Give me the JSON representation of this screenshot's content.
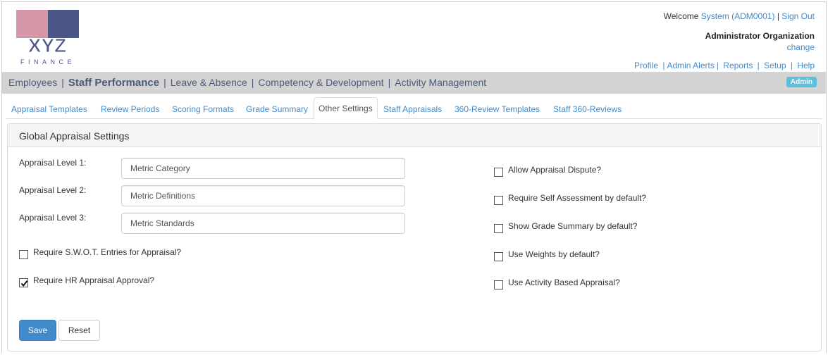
{
  "brand": {
    "logo_text": "XYZ",
    "logo_subtext": "FINANCE",
    "colors": {
      "pink": "#d596a8",
      "navy": "#4a5688"
    }
  },
  "header": {
    "welcome_label": "Welcome",
    "user_link": "System (ADM0001)",
    "separator": "|",
    "sign_out": "Sign Out",
    "organization": "Administrator Organization",
    "change_link": "change",
    "links": [
      "Profile",
      "Admin Alerts",
      "Reports",
      "Setup",
      "Help"
    ]
  },
  "main_nav": {
    "items": [
      {
        "label": "Employees",
        "active": false
      },
      {
        "label": "Staff Performance",
        "active": true
      },
      {
        "label": "Leave & Absence",
        "active": false
      },
      {
        "label": "Competency & Development",
        "active": false
      },
      {
        "label": "Activity Management",
        "active": false
      }
    ],
    "separator": "|",
    "role_badge": "Admin"
  },
  "sub_tabs": [
    {
      "label": "Appraisal Templates",
      "active": false
    },
    {
      "label": "Review Periods",
      "active": false
    },
    {
      "label": "Scoring Formats",
      "active": false
    },
    {
      "label": "Grade Summary",
      "active": false
    },
    {
      "label": "Other Settings",
      "active": true
    },
    {
      "label": "Staff Appraisals",
      "active": false
    },
    {
      "label": "360-Review Templates",
      "active": false
    },
    {
      "label": "Staff 360-Reviews",
      "active": false
    }
  ],
  "panel": {
    "title": "Global Appraisal Settings",
    "levels": [
      {
        "label": "Appraisal Level 1:",
        "value": "Metric Category"
      },
      {
        "label": "Appraisal Level 2:",
        "value": "Metric Definitions"
      },
      {
        "label": "Appraisal Level 3:",
        "value": "Metric Standards"
      }
    ],
    "left_checkboxes": [
      {
        "label": "Require S.W.O.T. Entries for Appraisal?",
        "checked": false
      },
      {
        "label": "Require HR Appraisal Approval?",
        "checked": true
      }
    ],
    "right_checkboxes": [
      {
        "label": "Allow Appraisal Dispute?",
        "checked": false
      },
      {
        "label": "Require Self Assessment by default?",
        "checked": false
      },
      {
        "label": "Show Grade Summary by default?",
        "checked": false
      },
      {
        "label": "Use Weights by default?",
        "checked": false
      },
      {
        "label": "Use Activity Based Appraisal?",
        "checked": false
      }
    ],
    "save_label": "Save",
    "reset_label": "Reset"
  }
}
